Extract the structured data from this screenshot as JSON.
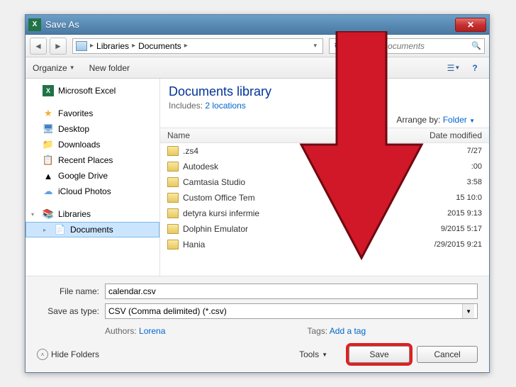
{
  "titlebar": {
    "title": "Save As",
    "close": "✕"
  },
  "nav": {
    "back": "◄",
    "fwd": "►",
    "crumb1": "Libraries",
    "crumb2": "Documents",
    "refresh": "↻",
    "search_placeholder": "Search Documents"
  },
  "toolbar": {
    "organize": "Organize",
    "newfolder": "New folder",
    "view": "☰",
    "help": "?"
  },
  "sidebar": {
    "excel": "Microsoft Excel",
    "favorites": "Favorites",
    "desktop": "Desktop",
    "downloads": "Downloads",
    "recent": "Recent Places",
    "gdrive": "Google Drive",
    "icloud": "iCloud Photos",
    "libraries": "Libraries",
    "documents": "Documents"
  },
  "content": {
    "title": "Documents library",
    "includes_pre": "Includes: ",
    "includes_link": "2 locations",
    "arrange_pre": "Arrange by: ",
    "arrange_link": "Folder",
    "col_name": "Name",
    "col_date": "Date modified",
    "files": [
      {
        "name": ".zs4",
        "date": "7/27"
      },
      {
        "name": "Autodesk",
        "date": ":00"
      },
      {
        "name": "Camtasia Studio",
        "date": "3:58"
      },
      {
        "name": "Custom Office Tem",
        "date": "15 10:0"
      },
      {
        "name": "detyra kursi infermie",
        "date": "2015 9:13"
      },
      {
        "name": "Dolphin Emulator",
        "date": "9/2015 5:17"
      },
      {
        "name": "Hania",
        "date": "/29/2015 9:21"
      }
    ]
  },
  "form": {
    "filename_lbl": "File name:",
    "filename_val": "calendar.csv",
    "savetype_lbl": "Save as type:",
    "savetype_val": "CSV (Comma delimited) (*.csv)",
    "authors_lbl": "Authors: ",
    "authors_val": "Lorena",
    "tags_lbl": "Tags: ",
    "tags_val": "Add a tag"
  },
  "buttons": {
    "hide": "Hide Folders",
    "tools": "Tools",
    "save": "Save",
    "cancel": "Cancel"
  }
}
